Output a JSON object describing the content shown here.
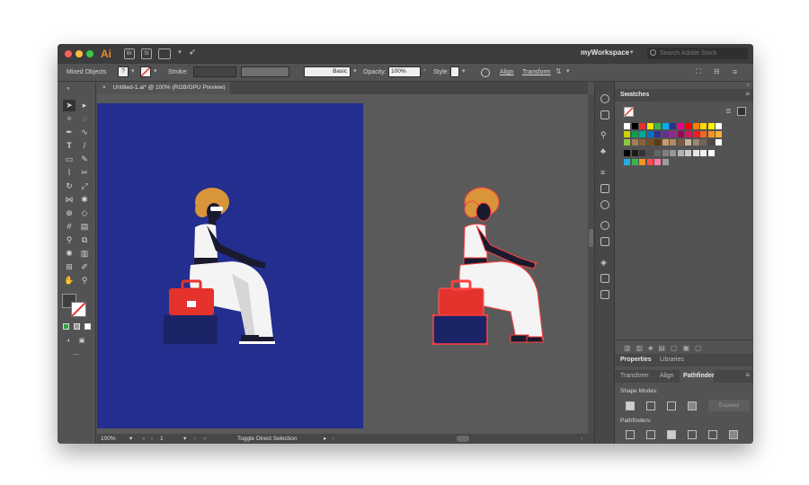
{
  "app": {
    "logo": "Ai",
    "workspace": "myWorkspace",
    "search_placeholder": "Search Adobe Stock",
    "bridge_label": "Br",
    "stock_label": "St"
  },
  "control_bar": {
    "selection": "Mixed Objects",
    "stroke_label": "Stroke:",
    "brush": "Basic",
    "opacity_label": "Opacity:",
    "opacity_value": "100%",
    "style_label": "Style:",
    "align": "Align",
    "transform": "Transform"
  },
  "document": {
    "tab_title": "Untitled-1.ai* @ 100% (RGB/GPU Preview)",
    "close_glyph": "×"
  },
  "status": {
    "zoom": "100%",
    "artboard": "1",
    "tool": "Toggle Direct Selection"
  },
  "swatches_panel": {
    "title": "Swatches",
    "rows": [
      [
        "#ffffff",
        "#000000",
        "#e5322d",
        "#ffe100",
        "#3ab54a",
        "#00aeef",
        "#2e3192",
        "#ec008c",
        "#ff0000",
        "#ff7f00",
        "#ffd700",
        "#fff200",
        "#ffffff"
      ],
      [
        "#c8d400",
        "#00a651",
        "#00a99d",
        "#0072bc",
        "#2e3192",
        "#662d91",
        "#92278f",
        "#9e005d",
        "#d7145a",
        "#ed1c24",
        "#f26522",
        "#f7941d",
        "#fbb040"
      ],
      [
        "#8dc63f",
        "#a67c52",
        "#8c6239",
        "#754c24",
        "#603913",
        "#c69c6d",
        "#b18b63",
        "#7d5a3c",
        "#c7b299",
        "#998675",
        "#736357",
        "#534741",
        "#ffffff"
      ],
      [
        "#000000",
        "#1a1a1a",
        "#333333",
        "#4d4d4d",
        "#666666",
        "#808080",
        "#999999",
        "#b3b3b3",
        "#cccccc",
        "#e6e6e6",
        "#f2f2f2",
        "#ffffff"
      ],
      [
        "#29abe2",
        "#39b54a",
        "#f7931e",
        "#ff4d4d",
        "#ff7bac",
        "#9e9e9e"
      ]
    ]
  },
  "properties_panel": {
    "tab_properties": "Properties",
    "tab_libraries": "Libraries",
    "sub_transform": "Transform",
    "sub_align": "Align",
    "sub_pathfinder": "Pathfinder",
    "shape_modes": "Shape Modes:",
    "expand": "Expand",
    "pathfinders": "Pathfinders:"
  },
  "colors": {
    "artboard": "#232e8e",
    "ui_dark": "#535353",
    "accent_orange": "#e8892e",
    "figure_red": "#e5322d"
  }
}
